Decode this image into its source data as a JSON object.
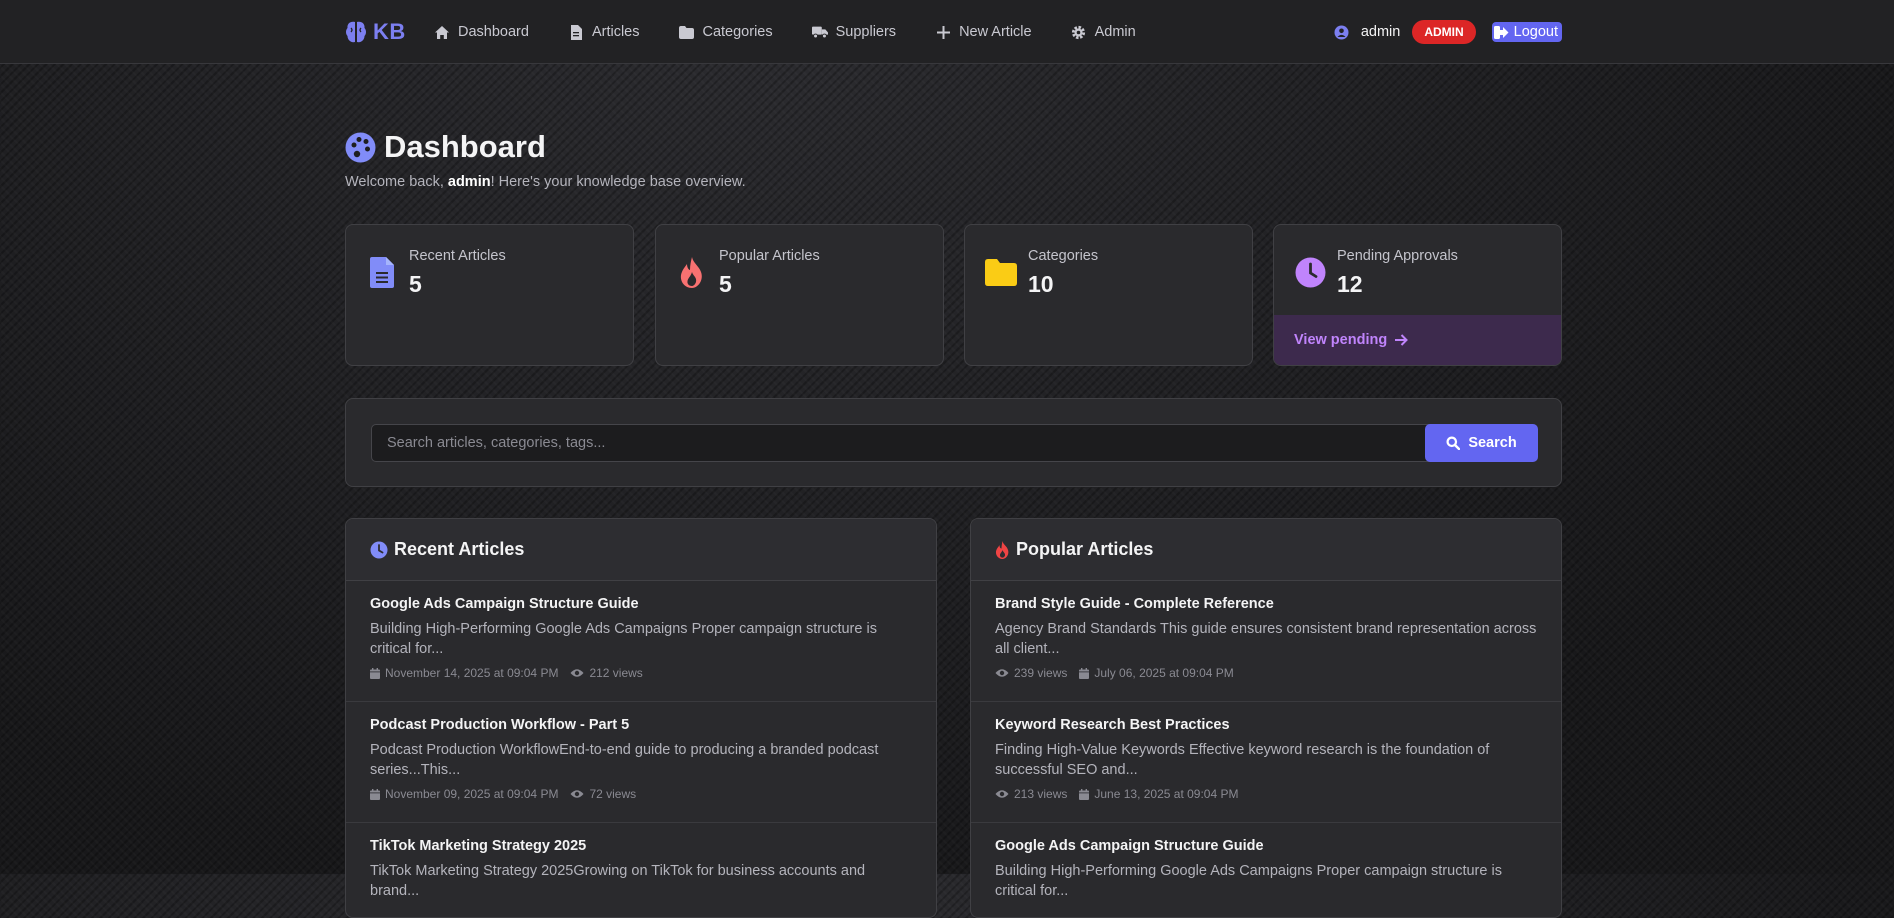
{
  "brand": {
    "name": "KB"
  },
  "nav": {
    "links": [
      {
        "label": "Dashboard"
      },
      {
        "label": "Articles"
      },
      {
        "label": "Categories"
      },
      {
        "label": "Suppliers"
      },
      {
        "label": "New Article"
      },
      {
        "label": "Admin"
      }
    ],
    "username": "admin",
    "role_badge": "ADMIN",
    "logout_label": "Logout"
  },
  "header": {
    "title": "Dashboard",
    "welcome_prefix": "Welcome back, ",
    "welcome_user": "admin",
    "welcome_suffix": "! Here's your knowledge base overview."
  },
  "stats": [
    {
      "label": "Recent Articles",
      "value": "5",
      "icon": "file-icon",
      "color": "#818cf8"
    },
    {
      "label": "Popular Articles",
      "value": "5",
      "icon": "fire-icon",
      "color": "#f87171"
    },
    {
      "label": "Categories",
      "value": "10",
      "icon": "folder-icon",
      "color": "#facc15"
    },
    {
      "label": "Pending Approvals",
      "value": "12",
      "icon": "clock-icon",
      "color": "#c084fc",
      "footer_label": "View pending"
    }
  ],
  "search": {
    "placeholder": "Search articles, categories, tags...",
    "button_label": "Search"
  },
  "recent": {
    "title": "Recent Articles",
    "items": [
      {
        "title": "Google Ads Campaign Structure Guide",
        "excerpt": "Building High-Performing Google Ads Campaigns Proper campaign structure is critical for...",
        "date": "November 14, 2025 at 09:04 PM",
        "views": "212 views"
      },
      {
        "title": "Podcast Production Workflow - Part 5",
        "excerpt": "Podcast Production WorkflowEnd-to-end guide to producing a branded podcast series...This...",
        "date": "November 09, 2025 at 09:04 PM",
        "views": "72 views"
      },
      {
        "title": "TikTok Marketing Strategy 2025",
        "excerpt": "TikTok Marketing Strategy 2025Growing on TikTok for business accounts and brand...",
        "date": "",
        "views": ""
      }
    ]
  },
  "popular": {
    "title": "Popular Articles",
    "items": [
      {
        "title": "Brand Style Guide - Complete Reference",
        "excerpt": "Agency Brand Standards This guide ensures consistent brand representation across all client...",
        "views": "239 views",
        "date": "July 06, 2025 at 09:04 PM"
      },
      {
        "title": "Keyword Research Best Practices",
        "excerpt": "Finding High-Value Keywords Effective keyword research is the foundation of successful SEO and...",
        "views": "213 views",
        "date": "June 13, 2025 at 09:04 PM"
      },
      {
        "title": "Google Ads Campaign Structure Guide",
        "excerpt": "Building High-Performing Google Ads Campaigns Proper campaign structure is critical for...",
        "views": "",
        "date": ""
      }
    ]
  }
}
